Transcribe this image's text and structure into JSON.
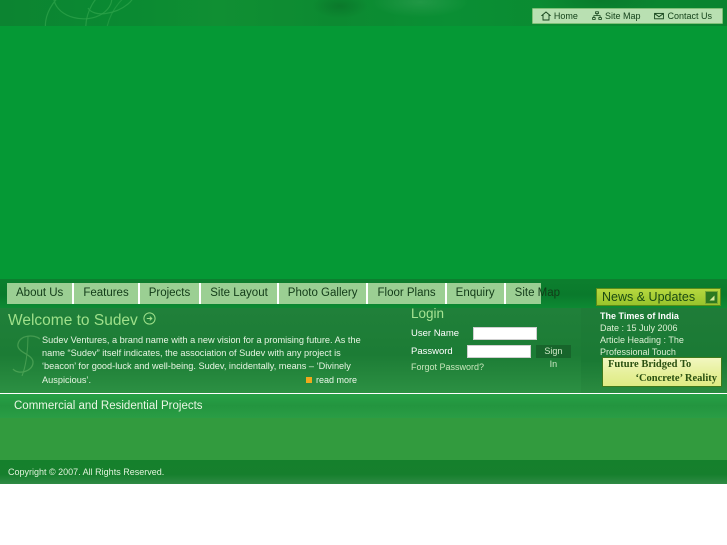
{
  "top_nav": {
    "items": [
      {
        "label": "Home",
        "icon": "home-icon"
      },
      {
        "label": "Site Map",
        "icon": "sitemap-icon"
      },
      {
        "label": "Contact Us",
        "icon": "envelope-icon"
      }
    ]
  },
  "tabs": [
    {
      "label": "About Us"
    },
    {
      "label": "Features"
    },
    {
      "label": "Projects"
    },
    {
      "label": "Site Layout"
    },
    {
      "label": "Photo Gallery"
    },
    {
      "label": "Floor Plans"
    },
    {
      "label": "Enquiry"
    },
    {
      "label": "Site Map"
    }
  ],
  "welcome": {
    "title": "Welcome to Sudev",
    "arrow_icon": "circle-arrow-right-icon",
    "body": "Sudev Ventures, a brand name with a new vision for a promising future. As the name “Sudev” itself indicates, the association of Sudev with any project is ‘beacon’ for good-luck and well-being. Sudev, incidentally, means – ‘Divinely Auspicious’.",
    "read_more": "read more",
    "read_more_bullet_color": "#f0a81c"
  },
  "login": {
    "title": "Login",
    "username_label": "User Name",
    "username_value": "",
    "username_placeholder": "",
    "password_label": "Password",
    "password_value": "",
    "password_placeholder": "",
    "signin_label": "Sign In",
    "forgot_label": "Forgot Password?"
  },
  "news": {
    "header_title": "News & Updates",
    "toggle_icon": "collapse-arrow-icon",
    "source": "The Times of India",
    "date_line": "Date : 15 July 2006",
    "heading_line_1": "Article Heading : The",
    "heading_line_2": "Professional Touch",
    "ad_line_1": "Future Bridged To",
    "ad_line_2": "‘Concrete’ Reality"
  },
  "projects_bar": {
    "text": "Commercial and Residential Projects"
  },
  "footer": {
    "text": "Copyright © 2007. All Rights Reserved."
  },
  "colors": {
    "hero_green": "#059935",
    "tab_bar_green": "#9bcf93",
    "panel_green": "#1c7c35",
    "news_accent": "#a8d133",
    "ad_yellow": "#e6f09a",
    "footer_green": "#167f2d"
  }
}
